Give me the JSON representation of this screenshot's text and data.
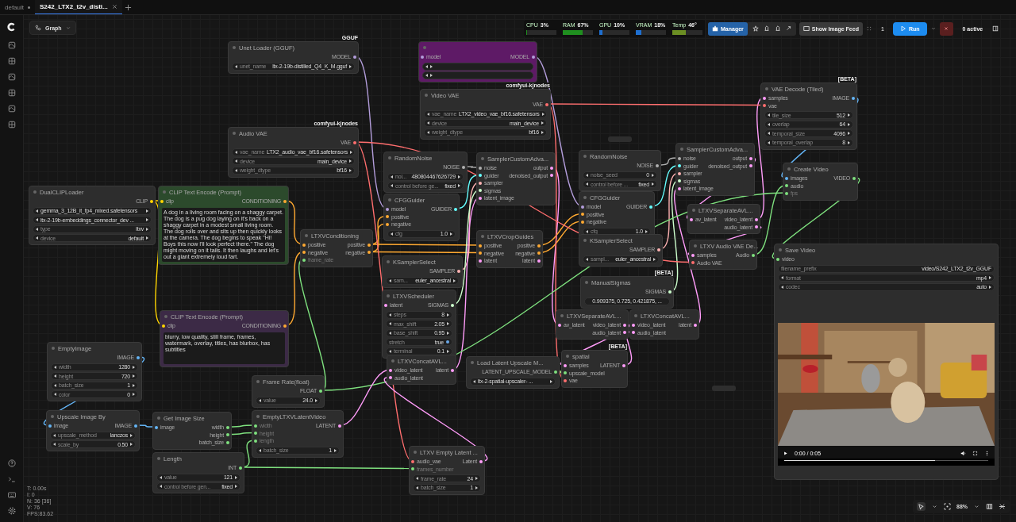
{
  "tabs": [
    {
      "label": "default",
      "selected": false,
      "unsaved": true
    },
    {
      "label": "S242_LTX2_t2v_disti...",
      "selected": true,
      "unsaved": false
    }
  ],
  "graph_button": "Graph",
  "monitors": [
    {
      "label": "CPU",
      "value": "3%",
      "level": 0.03,
      "color": "#1f8f1f"
    },
    {
      "label": "RAM",
      "value": "67%",
      "level": 0.67,
      "color": "#1f8f1f"
    },
    {
      "label": "GPU",
      "value": "10%",
      "level": 0.1,
      "color": "#1e6fd0"
    },
    {
      "label": "VRAM",
      "value": "18%",
      "level": 0.18,
      "color": "#1e6fd0"
    },
    {
      "label": "Temp",
      "value": "46°",
      "level": 0.46,
      "color": "#6b8e23"
    }
  ],
  "manager_button": "Manager",
  "image_feed_button": "Show Image Feed",
  "queue_count": "1",
  "run_button": "Run",
  "active_count": "0 active",
  "nodes": [
    {
      "title": "Unet Loader (GGUF)",
      "badge": "GGUF",
      "outputs": [
        {
          "name": "MODEL",
          "color": "#b39ddb"
        }
      ],
      "widgets": [
        {
          "kind": "stepper",
          "label": "unet_name",
          "value": "ltx-2-19b-distilled_Q4_K_M.gguf"
        }
      ]
    },
    {
      "color": "#5e1a66",
      "inputs": [
        {
          "name": "model",
          "color": "#b39ddb"
        }
      ],
      "outputs": [
        {
          "name": "MODEL",
          "color": "#b39ddb"
        }
      ],
      "widgets": [
        {
          "kind": "stepper"
        },
        {
          "kind": "stepper"
        }
      ]
    },
    {
      "title": "Video VAE",
      "badge": "comfyui-kjnodes",
      "outputs": [
        {
          "name": "VAE",
          "color": "#ff6e6e"
        }
      ],
      "widgets": [
        {
          "kind": "stepper",
          "label": "vae_name",
          "value": "LTX2_video_vae_bf16.safetensors"
        },
        {
          "kind": "stepper",
          "label": "device",
          "value": "main_device"
        },
        {
          "kind": "stepper",
          "label": "weight_dtype",
          "value": "bf16"
        }
      ]
    },
    {
      "title": "VAE Decode (Tiled)",
      "badge": "[BETA]",
      "inputs": [
        {
          "name": "samples",
          "color": "#ff9cf9"
        },
        {
          "name": "vae",
          "color": "#ff6e6e"
        }
      ],
      "outputs": [
        {
          "name": "IMAGE",
          "color": "#64b5f6"
        }
      ],
      "widgets": [
        {
          "kind": "stepper",
          "label": "tile_size",
          "value": "512"
        },
        {
          "kind": "stepper",
          "label": "overlap",
          "value": "64"
        },
        {
          "kind": "stepper",
          "label": "temporal_size",
          "value": "4096"
        },
        {
          "kind": "stepper",
          "label": "temporal_overlap",
          "value": "8"
        }
      ]
    },
    {
      "title": "Audio VAE",
      "badge": "comfyui-kjnodes",
      "outputs": [
        {
          "name": "VAE",
          "color": "#ff6e6e"
        }
      ],
      "widgets": [
        {
          "kind": "stepper",
          "label": "vae_name",
          "value": "LTX2_audio_vae_bf16.safetensors"
        },
        {
          "kind": "stepper",
          "label": "device",
          "value": "main_device"
        },
        {
          "kind": "stepper",
          "label": "weight_dtype",
          "value": "bf16"
        }
      ]
    },
    {
      "title": "RandomNoise",
      "outputs": [
        {
          "name": "NOISE",
          "color": "#b0b0b0"
        }
      ],
      "widgets": [
        {
          "kind": "stepper",
          "label": "noi...",
          "value": "480804467626729"
        },
        {
          "kind": "stepper",
          "label": "control before ge...",
          "value": "fixed"
        }
      ]
    },
    {
      "title": "SamplerCustomAdva...",
      "inputs": [
        {
          "name": "noise",
          "color": "#b0b0b0"
        },
        {
          "name": "guider",
          "color": "#66ffff"
        },
        {
          "name": "sampler",
          "color": "#ffb3b3"
        },
        {
          "name": "sigmas",
          "color": "#cdffcd"
        },
        {
          "name": "latent_image",
          "color": "#ff9cf9"
        }
      ],
      "outputs": [
        {
          "name": "output",
          "color": "#ff9cf9"
        },
        {
          "name": "denoised_output",
          "color": "#ff9cf9"
        }
      ]
    },
    {
      "title": "RandomNoise",
      "outputs": [
        {
          "name": "NOISE",
          "color": "#b0b0b0"
        }
      ],
      "widgets": [
        {
          "kind": "stepper",
          "label": "noise_seed",
          "value": "0"
        },
        {
          "kind": "stepper",
          "label": "control before ...",
          "value": "fixed"
        }
      ]
    },
    {
      "title": "SamplerCustomAdva...",
      "inputs": [
        {
          "name": "noise",
          "color": "#b0b0b0"
        },
        {
          "name": "guider",
          "color": "#66ffff"
        },
        {
          "name": "sampler",
          "color": "#ffb3b3"
        },
        {
          "name": "sigmas",
          "color": "#cdffcd"
        },
        {
          "name": "latent_image",
          "color": "#ff9cf9"
        }
      ],
      "outputs": [
        {
          "name": "output",
          "color": "#ff9cf9"
        },
        {
          "name": "denoised_output",
          "color": "#ff9cf9"
        }
      ]
    },
    {
      "title": "Create Video",
      "inputs": [
        {
          "name": "images",
          "color": "#64b5f6"
        },
        {
          "name": "audio",
          "color": "#7ee07e"
        }
      ],
      "widget_inputs": [
        {
          "name": "fps",
          "color": "#7ee07e"
        }
      ],
      "outputs": [
        {
          "name": "VIDEO",
          "color": "#7ee07e"
        }
      ]
    },
    {
      "title": "DualCLIPLoader",
      "outputs": [
        {
          "name": "CLIP",
          "color": "#ffd500"
        }
      ],
      "widgets": [
        {
          "kind": "stepper",
          "value": "gemma_3_12B_it_fp4_mixed.safetensors"
        },
        {
          "kind": "stepper",
          "value": "ltx-2-19b-embeddings_connector_dev ..."
        },
        {
          "kind": "stepper",
          "label": "type",
          "value": "ltxv"
        },
        {
          "kind": "stepper",
          "label": "device",
          "value": "default"
        }
      ]
    },
    {
      "title": "CLIP Text Encode (Prompt)",
      "color": "#2c4a2c",
      "inputs": [
        {
          "name": "clip",
          "color": "#ffd500"
        }
      ],
      "outputs": [
        {
          "name": "CONDITIONING",
          "color": "#ffa931"
        }
      ],
      "prompt": "A dog in a living room facing on a shaggy carpet. The dog is a pug dog laying on it's back on a shaggy carpet in a modest small living room. The dog rolls over and sits up then quickly looks at the camera. The dog begins to speak \"Hi! Boys this now I'll look perfect there.\" The dog might moving on it tails. It then laughs and let's out a giant extremely loud fart."
    },
    {
      "title": "CFGGuider",
      "inputs": [
        {
          "name": "model",
          "color": "#b39ddb"
        },
        {
          "name": "positive",
          "color": "#ffa931"
        },
        {
          "name": "negative",
          "color": "#ffa931"
        }
      ],
      "outputs": [
        {
          "name": "GUIDER",
          "color": "#66ffff"
        }
      ],
      "widgets": [
        {
          "kind": "stepper",
          "label": "cfg",
          "value": "1.0"
        }
      ]
    },
    {
      "title": "CFGGuider",
      "inputs": [
        {
          "name": "model",
          "color": "#b39ddb"
        },
        {
          "name": "positive",
          "color": "#ffa931"
        },
        {
          "name": "negative",
          "color": "#ffa931"
        }
      ],
      "outputs": [
        {
          "name": "GUIDER",
          "color": "#66ffff"
        }
      ],
      "widgets": [
        {
          "kind": "stepper",
          "label": "cfg",
          "value": "1.0"
        }
      ]
    },
    {
      "title": "LTXVSeparateAVL...",
      "inputs": [
        {
          "name": "av_latent",
          "color": "#ff9cf9"
        }
      ],
      "outputs": [
        {
          "name": "video_latent",
          "color": "#ff9cf9"
        },
        {
          "name": "audio_latent",
          "color": "#ff9cf9"
        }
      ]
    },
    {
      "title": "LTXVConditioning",
      "inputs": [
        {
          "name": "positive",
          "color": "#ffa931"
        },
        {
          "name": "negative",
          "color": "#ffa931"
        }
      ],
      "widget_inputs": [
        {
          "name": "frame_rate",
          "color": "#7ee07e"
        }
      ],
      "outputs": [
        {
          "name": "positive",
          "color": "#ffa931"
        },
        {
          "name": "negative",
          "color": "#ffa931"
        }
      ]
    },
    {
      "title": "LTXVCropGuides",
      "inputs": [
        {
          "name": "positive",
          "color": "#ffa931"
        },
        {
          "name": "negative",
          "color": "#ffa931"
        },
        {
          "name": "latent",
          "color": "#ff9cf9"
        }
      ],
      "outputs": [
        {
          "name": "positive",
          "color": "#ffa931"
        },
        {
          "name": "negative",
          "color": "#ffa931"
        },
        {
          "name": "latent",
          "color": "#ff9cf9"
        }
      ]
    },
    {
      "title": "KSamplerSelect",
      "outputs": [
        {
          "name": "SAMPLER",
          "color": "#ffb3b3"
        }
      ],
      "widgets": [
        {
          "kind": "stepper",
          "label": "sampl...",
          "value": "euler_ancestral"
        }
      ]
    },
    {
      "title": "LTXV Audio VAE De...",
      "inputs": [
        {
          "name": "samples",
          "color": "#ff9cf9"
        },
        {
          "name": "Audio VAE",
          "color": "#ff6e6e"
        }
      ],
      "outputs": [
        {
          "name": "Audio",
          "color": "#7ee07e"
        }
      ]
    },
    {
      "title": "Save Video",
      "inputs": [
        {
          "name": "video",
          "color": "#7ee07e"
        }
      ],
      "widgets": [
        {
          "kind": "text",
          "label": "filename_prefix",
          "value": "video/S242_LTX2_t2v_GGUF"
        },
        {
          "kind": "stepper",
          "label": "format",
          "value": "mp4"
        },
        {
          "kind": "stepper",
          "label": "codec",
          "value": "auto"
        }
      ],
      "video": {
        "time": "0:00 / 0:05",
        "level": 0.74
      }
    },
    {
      "title": "KSamplerSelect",
      "outputs": [
        {
          "name": "SAMPLER",
          "color": "#ffb3b3"
        }
      ],
      "widgets": [
        {
          "kind": "stepper",
          "label": "sam...",
          "value": "euler_ancestral"
        }
      ]
    },
    {
      "title": "CLIP Text Encode (Prompt)",
      "color": "#3c2a46",
      "inputs": [
        {
          "name": "clip",
          "color": "#ffd500"
        }
      ],
      "outputs": [
        {
          "name": "CONDITIONING",
          "color": "#ffa931"
        }
      ],
      "prompt": "blurry, low quality, still frame, frames, watermark, overlay, titles, has blurbox, has subtitles"
    },
    {
      "title": "LTXVScheduler",
      "inputs": [
        {
          "name": "latent",
          "color": "#ff9cf9"
        }
      ],
      "outputs": [
        {
          "name": "SIGMAS",
          "color": "#cdffcd"
        }
      ],
      "widgets": [
        {
          "kind": "stepper",
          "label": "steps",
          "value": "8"
        },
        {
          "kind": "stepper",
          "label": "max_shift",
          "value": "2.05"
        },
        {
          "kind": "stepper",
          "label": "base_shift",
          "value": "0.95"
        },
        {
          "kind": "toggle",
          "label": "stretch",
          "value": "true",
          "on": true
        },
        {
          "kind": "stepper",
          "label": "terminal",
          "value": "0.1"
        }
      ]
    },
    {
      "title": "ManualSigmas",
      "badge": "[BETA]",
      "outputs": [
        {
          "name": "SIGMAS",
          "color": "#cdffcd"
        }
      ],
      "widgets": [
        {
          "kind": "text",
          "value": "0.909375, 0.725, 0.421875, ..."
        }
      ]
    },
    {
      "title": "LTXVSeparateAVL...",
      "inputs": [
        {
          "name": "av_latent",
          "color": "#ff9cf9"
        }
      ],
      "outputs": [
        {
          "name": "video_latent",
          "color": "#ff9cf9"
        },
        {
          "name": "audio_latent",
          "color": "#ff9cf9"
        }
      ]
    },
    {
      "title": "LTXVConcatAVL...",
      "inputs": [
        {
          "name": "video_latent",
          "color": "#ff9cf9"
        },
        {
          "name": "audio_latent",
          "color": "#ff9cf9"
        }
      ],
      "outputs": [
        {
          "name": "latent",
          "color": "#ff9cf9"
        }
      ]
    },
    {
      "title": "EmptyImage",
      "outputs": [
        {
          "name": "IMAGE",
          "color": "#64b5f6"
        }
      ],
      "widgets": [
        {
          "kind": "stepper",
          "label": "width",
          "value": "1280"
        },
        {
          "kind": "stepper",
          "label": "height",
          "value": "720"
        },
        {
          "kind": "stepper",
          "label": "batch_size",
          "value": "1"
        },
        {
          "kind": "stepper",
          "label": "color",
          "value": "0"
        }
      ]
    },
    {
      "title": "LTXVConcatAVL...",
      "inputs": [
        {
          "name": "video_latent",
          "color": "#ff9cf9"
        },
        {
          "name": "audio_latent",
          "color": "#ff9cf9"
        }
      ],
      "outputs": [
        {
          "name": "latent",
          "color": "#ff9cf9"
        }
      ]
    },
    {
      "title": "Load Latent Upscale M...",
      "outputs": [
        {
          "name": "LATENT_UPSCALE_MODEL",
          "color": "#7ee07e"
        }
      ],
      "widgets": [
        {
          "kind": "stepper",
          "value": "ltx-2-spatial-upscaler- ..."
        }
      ]
    },
    {
      "title": "spatial",
      "badge": "[BETA]",
      "inputs": [
        {
          "name": "samples",
          "color": "#ff9cf9"
        },
        {
          "name": "upscale_model",
          "color": "#7ee07e"
        },
        {
          "name": "vae",
          "color": "#ff6e6e"
        }
      ],
      "outputs": [
        {
          "name": "LATENT",
          "color": "#ff9cf9"
        }
      ]
    },
    {
      "title": "Frame Rate(float)",
      "outputs": [
        {
          "name": "FLOAT",
          "color": "#7ee07e"
        }
      ],
      "widgets": [
        {
          "kind": "stepper",
          "label": "value",
          "value": "24.0"
        }
      ]
    },
    {
      "title": "Upscale Image By",
      "inputs": [
        {
          "name": "image",
          "color": "#64b5f6"
        }
      ],
      "outputs": [
        {
          "name": "IMAGE",
          "color": "#64b5f6"
        }
      ],
      "widgets": [
        {
          "kind": "stepper",
          "label": "upscale_method",
          "value": "lanczos"
        },
        {
          "kind": "stepper",
          "label": "scale_by",
          "value": "0.50"
        }
      ]
    },
    {
      "title": "Get Image Size",
      "inputs": [
        {
          "name": "image",
          "color": "#64b5f6"
        }
      ],
      "outputs": [
        {
          "name": "width",
          "color": "#7ee07e"
        },
        {
          "name": "height",
          "color": "#7ee07e"
        },
        {
          "name": "batch_size",
          "color": "#7ee07e"
        }
      ]
    },
    {
      "title": "EmptyLTXVLatentVideo",
      "widget_inputs": [
        {
          "name": "width",
          "color": "#7ee07e"
        },
        {
          "name": "height",
          "color": "#7ee07e"
        },
        {
          "name": "length",
          "color": "#7ee07e"
        }
      ],
      "outputs": [
        {
          "name": "LATENT",
          "color": "#ff9cf9"
        }
      ],
      "widgets": [
        {
          "kind": "stepper",
          "label": "batch_size",
          "value": "1"
        }
      ]
    },
    {
      "title": "Length",
      "outputs": [
        {
          "name": "INT",
          "color": "#7ee07e"
        }
      ],
      "widgets": [
        {
          "kind": "stepper",
          "label": "value",
          "value": "121"
        },
        {
          "kind": "stepper",
          "label": "control before gen...",
          "value": "fixed"
        }
      ]
    },
    {
      "title": "LTXV Empty Latent ...",
      "inputs": [
        {
          "name": "audio_vae",
          "color": "#ff6e6e"
        }
      ],
      "widget_inputs": [
        {
          "name": "frames_number",
          "color": "#7ee07e"
        }
      ],
      "outputs": [
        {
          "name": "Latent",
          "color": "#ff9cf9"
        }
      ],
      "widgets": [
        {
          "kind": "stepper",
          "label": "frame_rate",
          "value": "24"
        },
        {
          "kind": "stepper",
          "label": "batch_size",
          "value": "1"
        }
      ]
    }
  ],
  "stats": [
    "T: 0.00s",
    "I: 0",
    "N: 36 [36]",
    "V: 76",
    "FPS:83.62"
  ],
  "zoom": "88%"
}
